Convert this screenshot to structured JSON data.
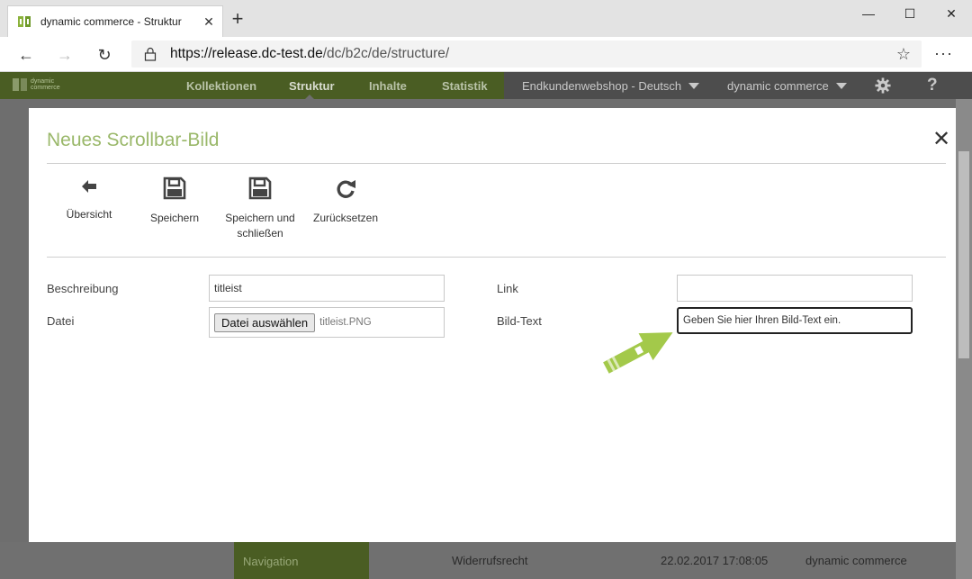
{
  "browser": {
    "tab_title": "dynamic commerce - Struktur",
    "new_tab": "+",
    "url_host": "https://release.dc-test.de",
    "url_path": "/dc/b2c/de/structure/"
  },
  "app": {
    "logo_line1": "dynamic",
    "logo_line2": "commerce",
    "nav": [
      "Kollektionen",
      "Struktur",
      "Inhalte",
      "Statistik"
    ],
    "active_nav": "Struktur",
    "shop_selector": "Endkundenwebshop - Deutsch",
    "company_selector": "dynamic commerce",
    "help": "?"
  },
  "modal": {
    "title": "Neues Scrollbar-Bild",
    "toolbar": {
      "overview": "Übersicht",
      "save": "Speichern",
      "save_close_1": "Speichern und",
      "save_close_2": "schließen",
      "reset": "Zurücksetzen"
    },
    "form": {
      "desc_label": "Beschreibung",
      "desc_value": "titleist",
      "file_label": "Datei",
      "file_button": "Datei auswählen",
      "file_name": "titleist.PNG",
      "link_label": "Link",
      "link_value": "",
      "bild_label": "Bild-Text",
      "bild_placeholder": "Geben Sie hier Ihren Bild-Text ein."
    }
  },
  "background_row": {
    "nav": "Navigation",
    "name": "Widerrufsrecht",
    "date": "22.02.2017 17:08:05",
    "user": "dynamic commerce"
  },
  "colors": {
    "brand_green": "#9ab86a",
    "header_green": "#4a5d23",
    "arrow_green": "#a3c94a"
  }
}
